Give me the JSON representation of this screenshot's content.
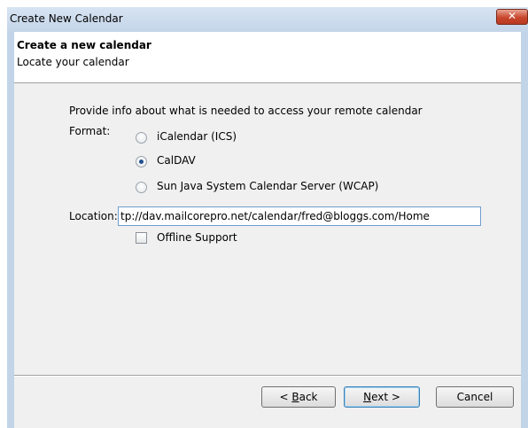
{
  "window": {
    "title": "Create New Calendar",
    "close_label": "✕"
  },
  "header": {
    "title": "Create a new calendar",
    "subtitle": "Locate your calendar"
  },
  "form": {
    "intro": "Provide info about what is needed to access your remote calendar",
    "format_label": "Format:",
    "formats": [
      {
        "label": "iCalendar (ICS)",
        "checked": false
      },
      {
        "label": "CalDAV",
        "checked": true
      },
      {
        "label": "Sun Java System Calendar Server (WCAP)",
        "checked": false
      }
    ],
    "location_label": "Location:",
    "location_value": "tp://dav.mailcorepro.net/calendar/fred@bloggs.com/Home",
    "offline_label": "Offline Support",
    "offline_checked": false
  },
  "buttons": {
    "back_prefix": "< ",
    "back_key": "B",
    "back_rest": "ack",
    "next_key": "N",
    "next_rest": "ext >",
    "cancel": "Cancel"
  }
}
